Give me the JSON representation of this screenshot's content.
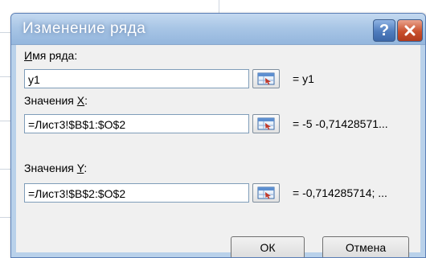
{
  "dialog": {
    "title": "Изменение ряда",
    "help_icon": "question-mark",
    "close_icon": "x-mark",
    "series_name": {
      "label_before": "",
      "label_underlined": "И",
      "label_after": "мя ряда:",
      "value": "y1",
      "preview": "= y1"
    },
    "x_values": {
      "label_before": "Значения ",
      "label_underlined": "X",
      "label_after": ":",
      "value": "=Лист3!$B$1:$O$2",
      "preview": "= -5 -0,71428571..."
    },
    "y_values": {
      "label_before": "Значения ",
      "label_underlined": "Y",
      "label_after": ":",
      "value": "=Лист3!$B$2:$O$2",
      "preview": "= -0,714285714; ..."
    },
    "ok_label": "ОК",
    "cancel_label": "Отмена"
  }
}
